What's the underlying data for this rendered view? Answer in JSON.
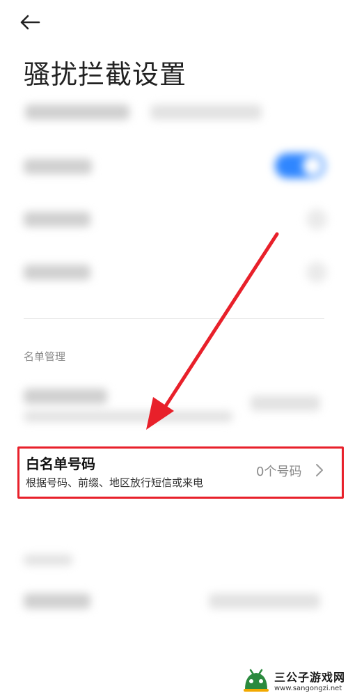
{
  "header": {
    "back_icon": "arrow-left-icon",
    "title": "骚扰拦截设置"
  },
  "section": {
    "list_management_label": "名单管理"
  },
  "whitelist": {
    "title": "白名单号码",
    "description": "根据号码、前缀、地区放行短信或来电",
    "count": "0个号码",
    "chevron_icon": "chevron-right-icon"
  },
  "annotation": {
    "arrow_color": "#e8202a",
    "highlight_color": "#e8202a"
  },
  "watermark": {
    "name": "三公子游戏网",
    "url": "www.sangongzi.net"
  },
  "colors": {
    "toggle_on": "#2f86ff"
  }
}
